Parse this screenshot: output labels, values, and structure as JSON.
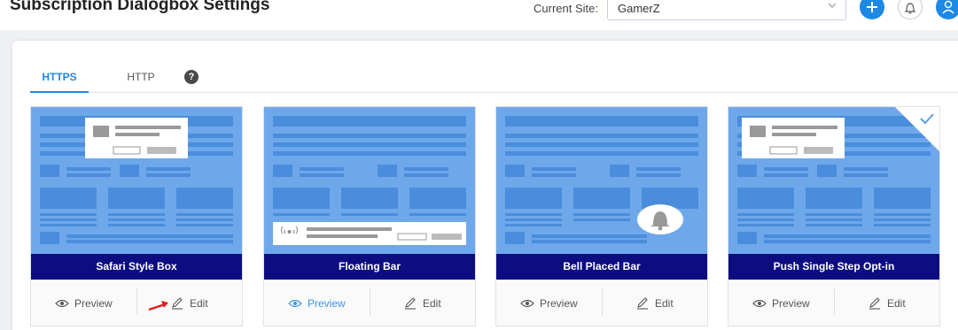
{
  "header": {
    "title": "Subscription Dialogbox Settings",
    "site_label": "Current Site:",
    "site_value": "GamerZ"
  },
  "colors": {
    "accent": "#1e88e5",
    "thumb_bg": "#6ea8ea",
    "thumb_block": "#4a8ddc",
    "title_bar": "#0d0d82"
  },
  "tabs": [
    {
      "label": "HTTPS",
      "active": true
    },
    {
      "label": "HTTP",
      "active": false
    }
  ],
  "help": "?",
  "cards": [
    {
      "title": "Safari Style Box",
      "preview": "Preview",
      "edit": "Edit",
      "selected": false,
      "preview_active": false
    },
    {
      "title": "Floating Bar",
      "preview": "Preview",
      "edit": "Edit",
      "selected": false,
      "preview_active": true
    },
    {
      "title": "Bell Placed Bar",
      "preview": "Preview",
      "edit": "Edit",
      "selected": false,
      "preview_active": false
    },
    {
      "title": "Push Single Step Opt-in",
      "preview": "Preview",
      "edit": "Edit",
      "selected": true,
      "preview_active": false
    }
  ]
}
